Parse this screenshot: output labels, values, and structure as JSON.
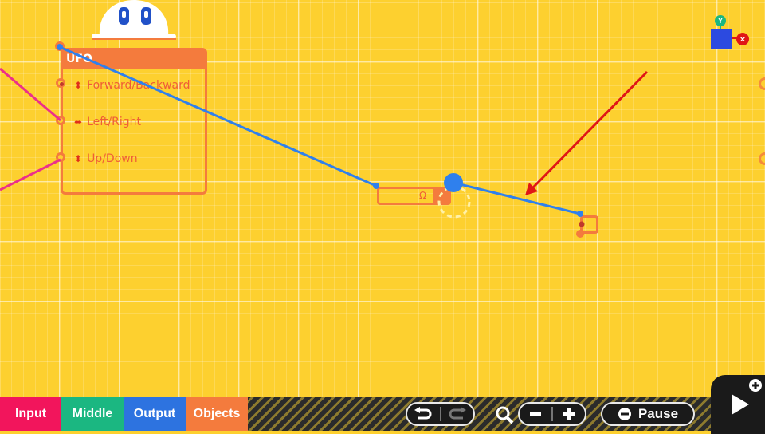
{
  "canvas": {
    "ufo_node": {
      "title": "UFO",
      "ports": [
        {
          "arrow": "⬍",
          "label": "Forward/Backward"
        },
        {
          "arrow": "⬌",
          "label": "Left/Right"
        },
        {
          "arrow": "⬍",
          "label": "Up/Down"
        }
      ]
    },
    "middle_node": {
      "glyph": "Ω"
    },
    "axis_gizmo": {
      "y_label": "Y",
      "x_label": "×"
    },
    "colors": {
      "canvas": "#fdd02f",
      "node_orange": "#f47b3d",
      "wire_blue": "#2f80ed",
      "wire_pink": "#ec2f8a",
      "arrow_red": "#e01616"
    }
  },
  "toolbar": {
    "tabs": [
      {
        "label": "Input",
        "color": "#f2155c"
      },
      {
        "label": "Middle",
        "color": "#1bb781"
      },
      {
        "label": "Output",
        "color": "#2d73e0"
      },
      {
        "label": "Objects",
        "color": "#f47b3d"
      }
    ],
    "undo_icon": "undo-icon",
    "redo_icon": "redo-icon",
    "zoom_icon": "magnifier-icon",
    "zoom_out_icon": "minus-icon",
    "zoom_in_icon": "plus-icon",
    "pause_label": "Pause",
    "play_icon": "play-icon"
  }
}
